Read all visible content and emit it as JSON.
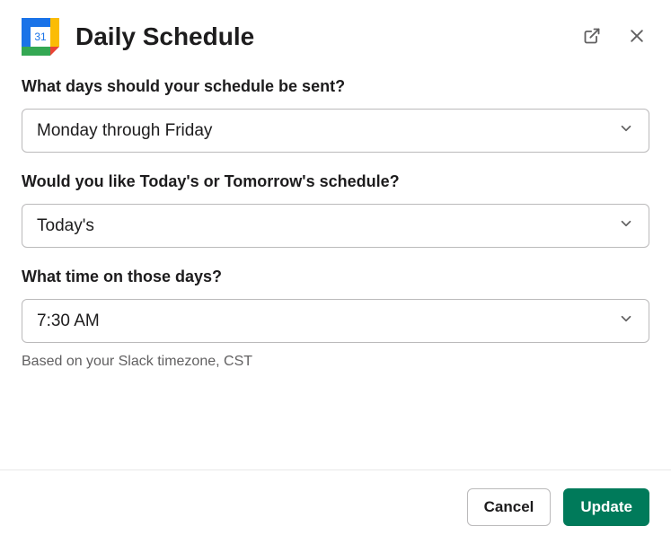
{
  "header": {
    "title": "Daily Schedule",
    "icon_day": "31"
  },
  "fields": {
    "days": {
      "label": "What days should your schedule be sent?",
      "value": "Monday through Friday"
    },
    "which": {
      "label": "Would you like Today's or Tomorrow's schedule?",
      "value": "Today's"
    },
    "time": {
      "label": "What time on those days?",
      "value": "7:30 AM",
      "helper": "Based on your Slack timezone, CST"
    }
  },
  "footer": {
    "cancel": "Cancel",
    "update": "Update"
  }
}
